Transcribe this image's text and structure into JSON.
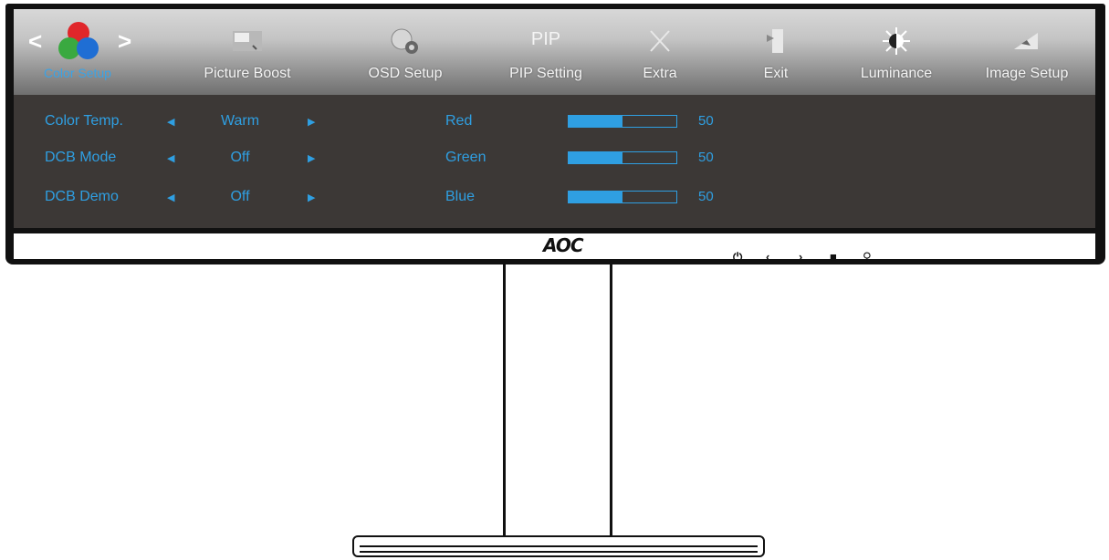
{
  "menu": {
    "items": [
      {
        "label": "Color Setup",
        "icon": "color-setup-icon"
      },
      {
        "label": "Picture Boost",
        "icon": "picture-boost-icon"
      },
      {
        "label": "OSD Setup",
        "icon": "osd-setup-icon"
      },
      {
        "label": "PIP Setting",
        "icon": "pip-icon",
        "icon_text": "PIP"
      },
      {
        "label": "Extra",
        "icon": "extra-icon"
      },
      {
        "label": "Exit",
        "icon": "exit-icon"
      },
      {
        "label": "Luminance",
        "icon": "luminance-icon"
      },
      {
        "label": "Image Setup",
        "icon": "image-setup-icon"
      }
    ],
    "nav_left": "<",
    "nav_right": ">"
  },
  "settings": [
    {
      "label": "Color Temp.",
      "value": "Warm"
    },
    {
      "label": "DCB Mode",
      "value": "Off"
    },
    {
      "label": "DCB Demo",
      "value": "Off"
    }
  ],
  "rgb": [
    {
      "label": "Red",
      "value": "50",
      "level": 0.5
    },
    {
      "label": "Green",
      "value": "50",
      "level": 0.5
    },
    {
      "label": "Blue",
      "value": "50",
      "level": 0.5
    }
  ],
  "bezel": {
    "logo": "AOC",
    "buttons": [
      "⏻",
      "‹",
      "›",
      "■",
      "⚲"
    ]
  },
  "colors": {
    "accent": "#2f9fe2",
    "panel": "#3c3836"
  }
}
